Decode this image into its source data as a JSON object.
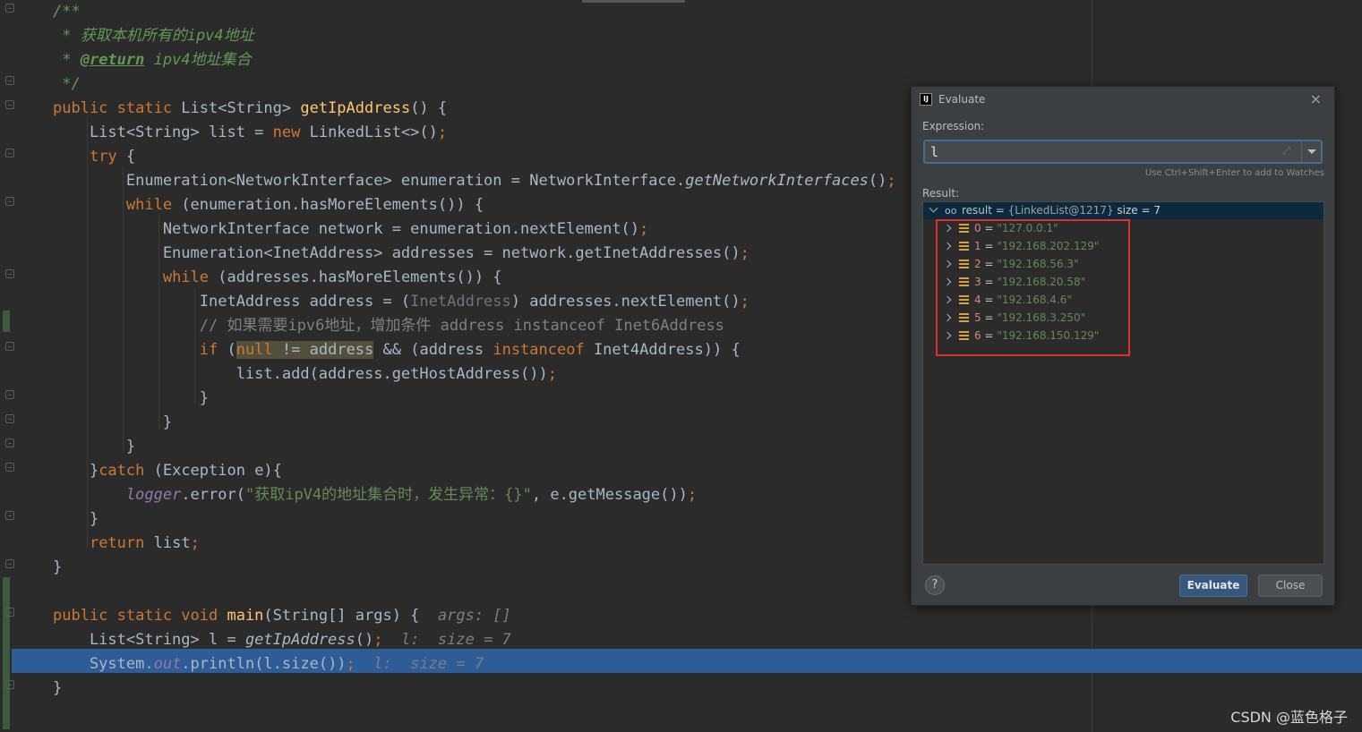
{
  "editor": {
    "lines": [
      [
        {
          "t": "/**",
          "c": "cm"
        }
      ],
      [
        {
          "t": " * 获取本机所有的ipv4地址",
          "c": "cm"
        }
      ],
      [
        {
          "t": " * ",
          "c": "cm"
        },
        {
          "t": "@return",
          "c": "cm u"
        },
        {
          "t": " ipv4地址集合",
          "c": "cm"
        }
      ],
      [
        {
          "t": " */",
          "c": "cm"
        }
      ],
      [
        {
          "t": "public static ",
          "c": "kw"
        },
        {
          "t": "List<String> "
        },
        {
          "t": "getIpAddress",
          "c": "fn"
        },
        {
          "t": "() {"
        }
      ],
      [
        {
          "t": "    List<String> list = "
        },
        {
          "t": "new ",
          "c": "kw"
        },
        {
          "t": "LinkedList<>()"
        },
        {
          "t": ";",
          "c": "kw"
        }
      ],
      [
        {
          "t": "    "
        },
        {
          "t": "try ",
          "c": "kw"
        },
        {
          "t": "{"
        }
      ],
      [
        {
          "t": "        Enumeration<NetworkInterface> enumeration = NetworkInterface."
        },
        {
          "t": "getNetworkInterfaces",
          "c": "st-i"
        },
        {
          "t": "()"
        },
        {
          "t": ";",
          "c": "kw"
        }
      ],
      [
        {
          "t": "        "
        },
        {
          "t": "while ",
          "c": "kw"
        },
        {
          "t": "(enumeration.hasMoreElements()) {"
        }
      ],
      [
        {
          "t": "            NetworkInterface network = enumeration.nextElement()"
        },
        {
          "t": ";",
          "c": "kw"
        }
      ],
      [
        {
          "t": "            Enumeration<InetAddress> addresses = network.getInetAddresses()"
        },
        {
          "t": ";",
          "c": "kw"
        }
      ],
      [
        {
          "t": "            "
        },
        {
          "t": "while ",
          "c": "kw"
        },
        {
          "t": "(addresses.hasMoreElements()) {"
        }
      ],
      [
        {
          "t": "                InetAddress address = ("
        },
        {
          "t": "InetAddress",
          "c": "dim"
        },
        {
          "t": ") addresses.nextElement()"
        },
        {
          "t": ";",
          "c": "kw"
        }
      ],
      [
        {
          "t": "                // 如果需要ipv6地址，增加条件 address instanceof Inet6Address",
          "c": "cmt"
        }
      ],
      [
        {
          "t": "                "
        },
        {
          "t": "if ",
          "c": "kw"
        },
        {
          "t": "("
        },
        {
          "t": "null",
          "c": "kw hl"
        },
        {
          "t": " != address",
          "c": "hl"
        },
        {
          "t": " && (address "
        },
        {
          "t": "instanceof ",
          "c": "kw"
        },
        {
          "t": "Inet4Address)) {"
        }
      ],
      [
        {
          "t": "                    list.add(address.getHostAddress())"
        },
        {
          "t": ";",
          "c": "kw"
        }
      ],
      [
        {
          "t": "                }"
        }
      ],
      [
        {
          "t": "            }"
        }
      ],
      [
        {
          "t": "        }"
        }
      ],
      [
        {
          "t": "    }"
        },
        {
          "t": "catch ",
          "c": "kw"
        },
        {
          "t": "(Exception e){"
        }
      ],
      [
        {
          "t": "        "
        },
        {
          "t": "logger",
          "c": "lg"
        },
        {
          "t": ".error("
        },
        {
          "t": "\"获取ipV4的地址集合时，发生异常：{}\"",
          "c": "str"
        },
        {
          "t": ", e.getMessage())"
        },
        {
          "t": ";",
          "c": "kw"
        }
      ],
      [
        {
          "t": "    }"
        }
      ],
      [
        {
          "t": "    "
        },
        {
          "t": "return ",
          "c": "kw"
        },
        {
          "t": "list"
        },
        {
          "t": ";",
          "c": "kw"
        }
      ],
      [
        {
          "t": "}"
        }
      ],
      [
        {
          "t": ""
        }
      ],
      [
        {
          "t": "public static void ",
          "c": "kw"
        },
        {
          "t": "main",
          "c": "fn"
        },
        {
          "t": "(String[] args) {  "
        },
        {
          "t": "args: []",
          "c": "hint"
        }
      ],
      [
        {
          "t": "    List<String> l = "
        },
        {
          "t": "getIpAddress",
          "c": "st-i"
        },
        {
          "t": "()"
        },
        {
          "t": ";",
          "c": "kw"
        },
        {
          "t": "  l:  size = 7",
          "c": "hint"
        }
      ],
      [
        {
          "t": "    System."
        },
        {
          "t": "out",
          "c": "fld"
        },
        {
          "t": ".println(l.size())"
        },
        {
          "t": ";",
          "c": "kw"
        },
        {
          "t": "  l:  size = 7",
          "c": "hint"
        }
      ],
      [
        {
          "t": "}"
        }
      ]
    ]
  },
  "dialog": {
    "app_icon": "IJ",
    "title": "Evaluate",
    "close_glyph": "×",
    "expression_label": "Expression:",
    "expression_value": "l",
    "expand_glyph": "⤢",
    "watch_hint": "Use Ctrl+Shift+Enter to add to Watches",
    "result_label": "Result:",
    "result": {
      "name": "result",
      "eq": " = ",
      "object": "{LinkedList@1217}",
      "size": "  size = 7",
      "items": [
        {
          "index": "0",
          "value": "\"127.0.0.1\""
        },
        {
          "index": "1",
          "value": "\"192.168.202.129\""
        },
        {
          "index": "2",
          "value": "\"192.168.56.3\""
        },
        {
          "index": "3",
          "value": "\"192.168.20.58\""
        },
        {
          "index": "4",
          "value": "\"192.168.4.6\""
        },
        {
          "index": "5",
          "value": "\"192.168.3.250\""
        },
        {
          "index": "6",
          "value": "\"192.168.150.129\""
        }
      ]
    },
    "help_label": "?",
    "evaluate_label": "Evaluate",
    "close_label": "Close"
  },
  "watermark": "CSDN @蓝色格子",
  "colors": {
    "background": "#2b2b2b",
    "keyword": "#cc7832",
    "method": "#ffc66d",
    "string": "#6a8759",
    "doc_comment": "#629755",
    "current_line": "#2d5c96",
    "annotation_box": "#e0302f"
  }
}
